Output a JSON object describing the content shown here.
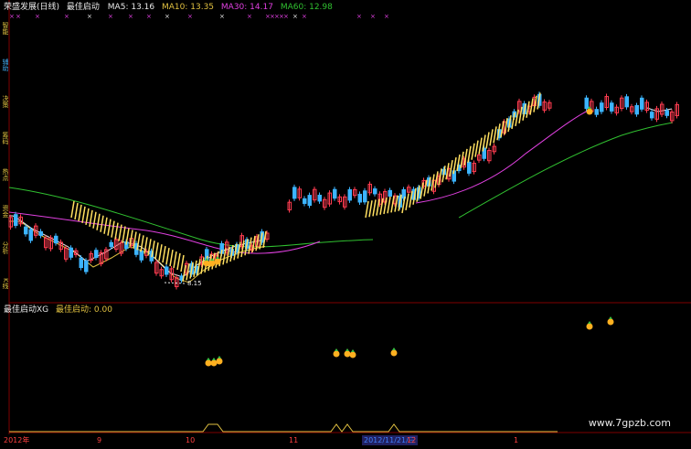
{
  "header": {
    "stock": "荣盛发展(日线)",
    "indicator": "最佳启动",
    "ma5": "MA5: 13.16",
    "ma10": "MA10: 13.35",
    "ma30": "MA30: 14.17",
    "ma60": "MA60: 12.98"
  },
  "sub_header": {
    "label": "最佳启动XG",
    "value": "最佳启动: 0.00"
  },
  "low_label": "8.15",
  "sidebar": [
    "智能",
    "辅助",
    "决策",
    "筹码",
    "热点",
    "资金",
    "分析",
    "K线"
  ],
  "x_axis": {
    "labels": [
      "2012年",
      "9",
      "10",
      "11",
      "2012/11/21/三",
      "12",
      "1"
    ],
    "highlight": "2012/11/21/三"
  },
  "watermark": "www.7gpzb.com",
  "colors": {
    "up": "#ff3c50",
    "down": "#3cb4ff",
    "ma5": "#e8e8e8",
    "ma10": "#e0c040",
    "ma30": "#e040e0",
    "ma60": "#30c030",
    "grid": "#800000",
    "signal_fill": "#ffe060"
  }
}
